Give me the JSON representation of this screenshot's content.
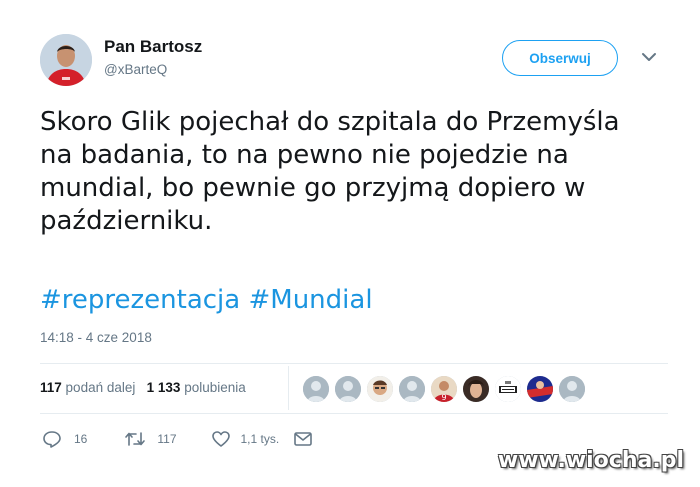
{
  "author": {
    "display_name": "Pan Bartosz",
    "handle": "@xBarteQ"
  },
  "follow_button": {
    "label": "Obserwuj"
  },
  "tweet": {
    "lines": [
      "Skoro Glik pojechał do szpitala do Przemyśla",
      "na badania, to na pewno nie pojedzie na",
      "mundial, bo pewnie go przyjmą dopiero w",
      "październiku."
    ],
    "hashtags": [
      "#reprezentacja",
      "#Mundial"
    ],
    "timestamp": "14:18 - 4 cze 2018"
  },
  "stats": {
    "retweets_count": "117",
    "retweets_label": "podań dalej",
    "likes_count": "1 133",
    "likes_label": "polubienia"
  },
  "actions": {
    "reply_count": "16",
    "retweet_count": "117",
    "like_count": "1,1 tys."
  },
  "icons": [
    "caret-down-icon",
    "reply-icon",
    "retweet-icon",
    "heart-icon",
    "message-icon"
  ],
  "colors": {
    "accent": "#1da1f2",
    "text": "#14171a",
    "muted": "#657786",
    "divider": "#e6ecf0"
  },
  "watermark": "www.wiocha.pl"
}
